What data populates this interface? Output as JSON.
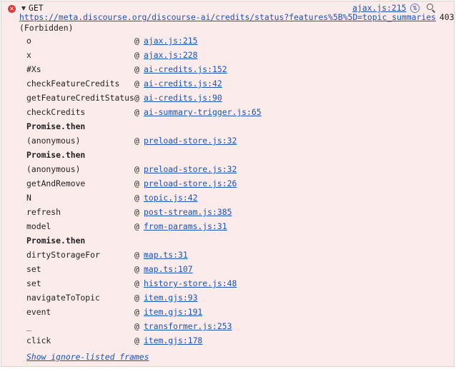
{
  "header": {
    "error_icon": "x-circle-icon",
    "method": "GET",
    "source": "ajax.js:215",
    "icon_1": "cors-icon",
    "icon_2": "search-icon"
  },
  "request": {
    "url": "https://meta.discourse.org/discourse-ai/credits/status?features%5B%5D=topic_summaries",
    "status_code": "403",
    "status_text": "(Forbidden)"
  },
  "frames": [
    {
      "fn": "o",
      "at": "@",
      "loc": "ajax.js:215"
    },
    {
      "fn": "x",
      "at": "@",
      "loc": "ajax.js:228"
    },
    {
      "fn": "#Xs",
      "at": "@",
      "loc": "ai-credits.js:152"
    },
    {
      "fn": "checkFeatureCredits",
      "at": "@",
      "loc": "ai-credits.js:42"
    },
    {
      "fn": "getFeatureCreditStatus",
      "at": "@",
      "loc": "ai-credits.js:90"
    },
    {
      "fn": "checkCredits",
      "at": "@",
      "loc": "ai-summary-trigger.js:65"
    },
    {
      "async": "Promise.then"
    },
    {
      "fn": "(anonymous)",
      "at": "@",
      "loc": "preload-store.js:32"
    },
    {
      "async": "Promise.then"
    },
    {
      "fn": "(anonymous)",
      "at": "@",
      "loc": "preload-store.js:32"
    },
    {
      "fn": "getAndRemove",
      "at": "@",
      "loc": "preload-store.js:26"
    },
    {
      "fn": "N",
      "at": "@",
      "loc": "topic.js:42"
    },
    {
      "fn": "refresh",
      "at": "@",
      "loc": "post-stream.js:385"
    },
    {
      "fn": "model",
      "at": "@",
      "loc": "from-params.js:31"
    },
    {
      "async": "Promise.then"
    },
    {
      "fn": "dirtyStorageFor",
      "at": "@",
      "loc": "map.ts:31"
    },
    {
      "fn": "set",
      "at": "@",
      "loc": "map.ts:107"
    },
    {
      "fn": "set",
      "at": "@",
      "loc": "history-store.js:48"
    },
    {
      "fn": "navigateToTopic",
      "at": "@",
      "loc": "item.gjs:93"
    },
    {
      "fn": "event",
      "at": "@",
      "loc": "item.gjs:191"
    },
    {
      "fn": "_",
      "at": "@",
      "loc": "transformer.js:253"
    },
    {
      "fn": "click",
      "at": "@",
      "loc": "item.gjs:178"
    }
  ],
  "footer": {
    "show_ignored": "Show ignore-listed frames"
  }
}
